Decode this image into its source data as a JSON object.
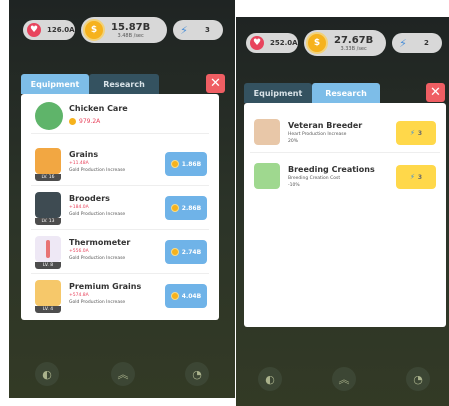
{
  "left": {
    "hud": {
      "hearts": "126.0A",
      "money": "15.87B",
      "rate": "3.48B /sec",
      "gems": "3"
    },
    "tabs": {
      "equipment": "Equipment",
      "research": "Research"
    },
    "header_item": {
      "name": "Chicken Care",
      "value": "979.2A"
    },
    "items": [
      {
        "name": "Grains",
        "gain": "+11.48A",
        "desc": "Gold Production Increase",
        "level": "LV. 16",
        "cost": "1.86B"
      },
      {
        "name": "Brooders",
        "gain": "+184.0A",
        "desc": "Gold Production Increase",
        "level": "LV. 13",
        "cost": "2.86B"
      },
      {
        "name": "Thermometer",
        "gain": "+556.0A",
        "desc": "Gold Production Increase",
        "level": "LV. 8",
        "cost": "2.74B"
      },
      {
        "name": "Premium Grains",
        "gain": "+574.8A",
        "desc": "Gold Production Increase",
        "level": "LV. 4",
        "cost": "4.04B"
      }
    ]
  },
  "right": {
    "hud": {
      "hearts": "252.0A",
      "money": "27.67B",
      "rate": "3.33B /sec",
      "gems": "2"
    },
    "tabs": {
      "equipment": "Equipment",
      "research": "Research"
    },
    "items": [
      {
        "name": "Veteran Breeder",
        "desc": "Heart Production Increase",
        "value": "20%",
        "cost": "3"
      },
      {
        "name": "Breeding Creations",
        "desc": "Breeding Creation Cost",
        "value": "-10%",
        "cost": "3"
      }
    ]
  },
  "icons": {
    "heart": "heart-icon",
    "coin": "coin-icon",
    "gem": "drop-icon",
    "close": "close-icon"
  }
}
